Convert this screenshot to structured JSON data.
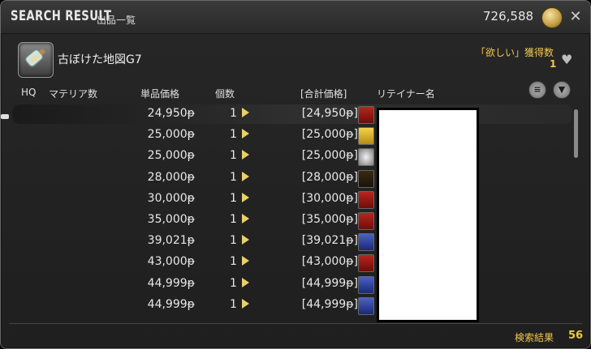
{
  "window": {
    "title": "SEARCH RESULT",
    "subtitle": "出品一覧",
    "gil": "726,588",
    "gil_icon": "gil-coin-icon",
    "close_icon": "close-icon"
  },
  "item": {
    "icon": "map-bottle-icon",
    "name": "古ぼけた地図G7",
    "wanted_label": "「欲しい」獲得数",
    "wanted_count": "1"
  },
  "columns": {
    "hq": "HQ",
    "materia": "マテリア数",
    "unit_price": "単品価格",
    "quantity": "個数",
    "total": "[合計価格]",
    "retainer": "リテイナー名"
  },
  "header_icons": [
    "history-icon",
    "filter-icon"
  ],
  "listings": [
    {
      "price": "24,950",
      "qty": "1",
      "total": "[24,950",
      "city": "red",
      "selected": true
    },
    {
      "price": "25,000",
      "qty": "1",
      "total": "[25,000",
      "city": "gold"
    },
    {
      "price": "25,000",
      "qty": "1",
      "total": "[25,000",
      "city": "gray"
    },
    {
      "price": "28,000",
      "qty": "1",
      "total": "[28,000",
      "city": "dark"
    },
    {
      "price": "30,000",
      "qty": "1",
      "total": "[30,000",
      "city": "red"
    },
    {
      "price": "35,000",
      "qty": "1",
      "total": "[35,000",
      "city": "red"
    },
    {
      "price": "39,021",
      "qty": "1",
      "total": "[39,021",
      "city": "blue"
    },
    {
      "price": "43,000",
      "qty": "1",
      "total": "[43,000",
      "city": "red"
    },
    {
      "price": "44,999",
      "qty": "1",
      "total": "[44,999",
      "city": "blue"
    },
    {
      "price": "44,999",
      "qty": "1",
      "total": "[44,999",
      "city": "blue"
    }
  ],
  "currency_suffix": "ᵽ",
  "total_close": "ᵽ]",
  "footer": {
    "label": "検索結果",
    "count": "56"
  }
}
